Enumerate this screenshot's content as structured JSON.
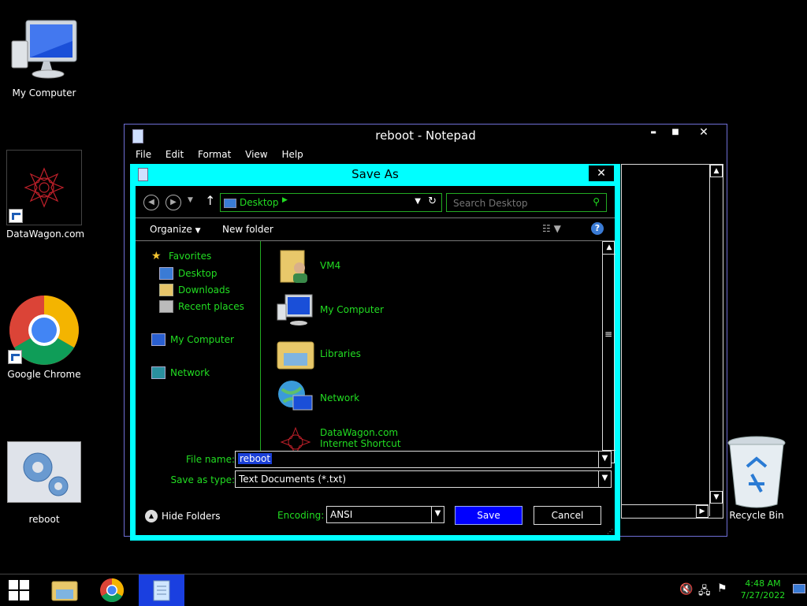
{
  "desktop": {
    "icons": [
      {
        "label": "My Computer"
      },
      {
        "label": "DataWagon.com"
      },
      {
        "label": "Google Chrome"
      },
      {
        "label": "reboot"
      },
      {
        "label": "Recycle Bin"
      }
    ]
  },
  "notepad": {
    "title": "reboot - Notepad",
    "menu": [
      "File",
      "Edit",
      "Format",
      "View",
      "Help"
    ],
    "controls": {
      "minimize": "▬",
      "maximize": "■",
      "close": "✕"
    }
  },
  "dialog": {
    "title": "Save As",
    "close_label": "✕",
    "address": {
      "location": "Desktop"
    },
    "search": {
      "placeholder": "Search Desktop"
    },
    "toolbar": {
      "organize": "Organize",
      "new_folder": "New folder"
    },
    "nav": {
      "favorites": "Favorites",
      "desktop": "Desktop",
      "downloads": "Downloads",
      "recent": "Recent places",
      "my_computer": "My Computer",
      "network": "Network"
    },
    "files": [
      {
        "name": "VM4",
        "icon": "user-folder-icon"
      },
      {
        "name": "My Computer",
        "icon": "computer-icon"
      },
      {
        "name": "Libraries",
        "icon": "libraries-icon"
      },
      {
        "name": "Network",
        "icon": "network-icon"
      },
      {
        "name": "DataWagon.com",
        "subtitle": "Internet Shortcut",
        "icon": "datawagon-icon"
      }
    ],
    "file_name_label": "File name:",
    "file_name_value": "reboot",
    "save_type_label": "Save as type:",
    "save_type_value": "Text Documents (*.txt)",
    "hide_folders": "Hide Folders",
    "encoding_label": "Encoding:",
    "encoding_value": "ANSI",
    "save_button": "Save",
    "cancel_button": "Cancel"
  },
  "taskbar": {
    "time": "4:48 AM",
    "date": "7/27/2022"
  },
  "colors": {
    "accent": "#00ffff",
    "green_text": "#22dd22",
    "save_button": "#0000ff"
  }
}
